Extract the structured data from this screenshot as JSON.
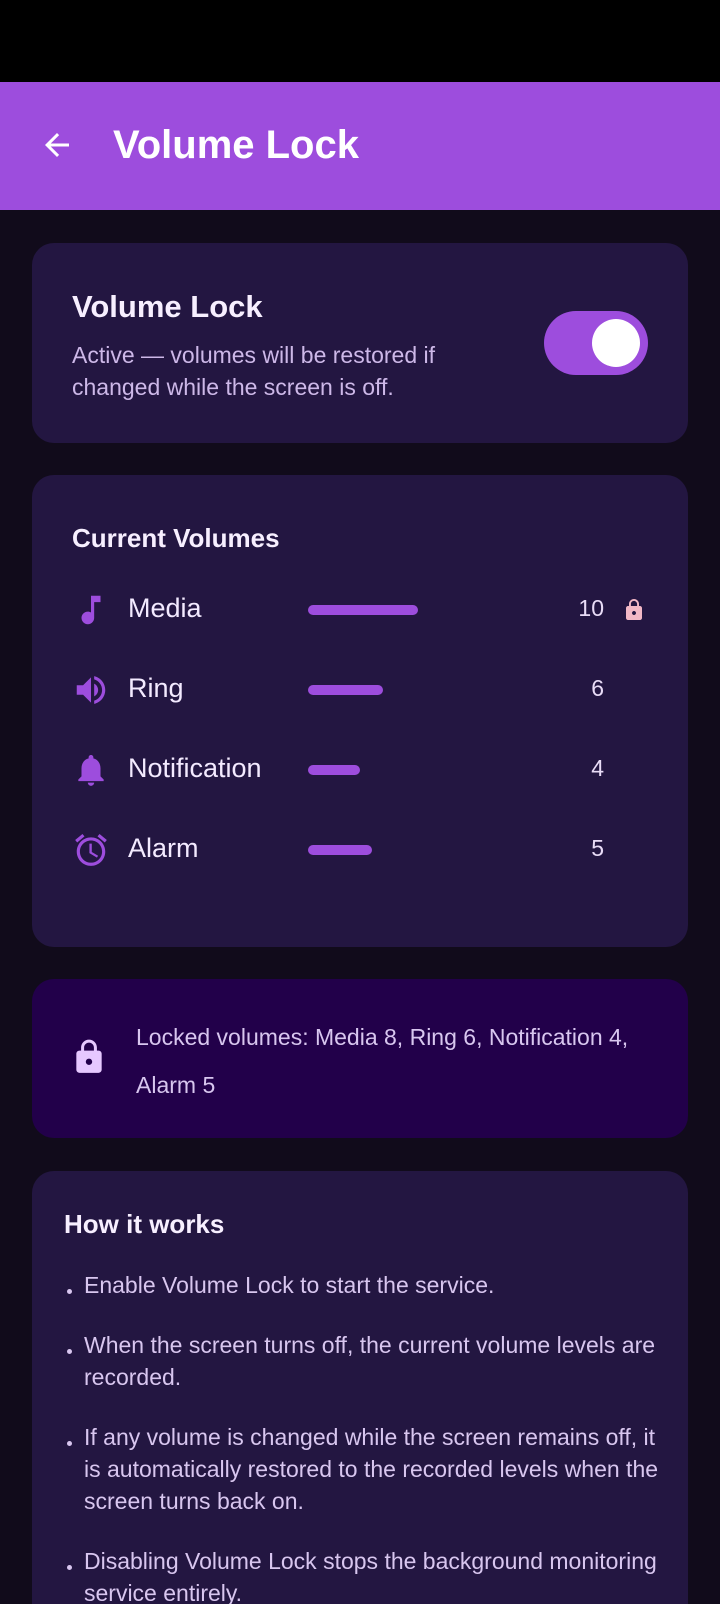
{
  "app_bar": {
    "title": "Volume Lock"
  },
  "lock_card": {
    "title": "Volume Lock",
    "description": "Active — volumes will be restored if changed while the screen is off.",
    "enabled": true
  },
  "volumes_card": {
    "title": "Current Volumes",
    "items": [
      {
        "icon": "music-note-icon",
        "label": "Media",
        "value": "10",
        "level_fraction": 0.67,
        "locked_indicator": true
      },
      {
        "icon": "speaker-icon",
        "label": "Ring",
        "value": "6",
        "level_fraction": 0.46,
        "locked_indicator": false
      },
      {
        "icon": "bell-icon",
        "label": "Notification",
        "value": "4",
        "level_fraction": 0.32,
        "locked_indicator": false
      },
      {
        "icon": "alarm-clock-icon",
        "label": "Alarm",
        "value": "5",
        "level_fraction": 0.39,
        "locked_indicator": false
      }
    ]
  },
  "locked_card": {
    "text": "Locked volumes: Media 8, Ring 6, Notification 4, Alarm 5"
  },
  "how_card": {
    "title": "How it works",
    "items": [
      "Enable Volume Lock to start the service.",
      "When the screen turns off, the current volume levels are recorded.",
      "If any volume is changed while the screen remains off, it is automatically restored to the recorded levels when the screen turns back on.",
      "Disabling Volume Lock stops the background monitoring service entirely."
    ]
  },
  "colors": {
    "accent": "#9d4ddd",
    "background": "#110b1b",
    "card": "#231641",
    "locked_card": "#22004a",
    "lock_indicator": "#f2b8c6"
  }
}
